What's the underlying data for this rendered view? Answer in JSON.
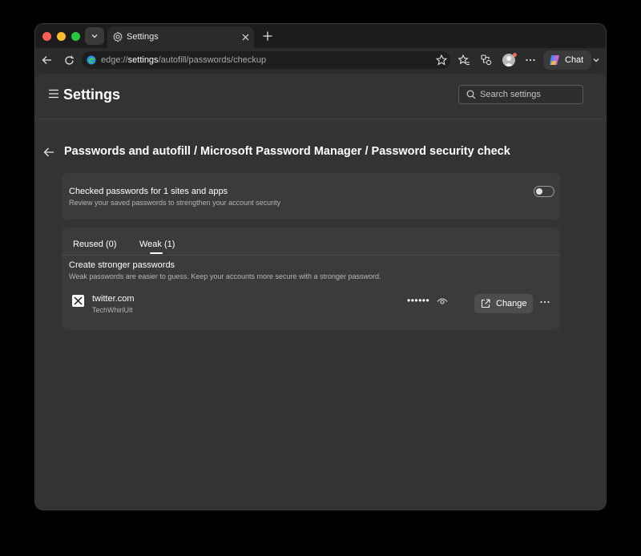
{
  "browser": {
    "tab": {
      "title": "Settings"
    },
    "address": {
      "url_prefix": "edge://",
      "url_bold": "settings",
      "url_rest": "/autofill/passwords/checkup"
    },
    "toolbar": {
      "chat_label": "Chat"
    }
  },
  "settings": {
    "title": "Settings",
    "search": {
      "placeholder": "Search settings"
    },
    "breadcrumb": "Passwords and autofill / Microsoft Password Manager / Password security check"
  },
  "checked_card": {
    "title": "Checked passwords for 1 sites and apps",
    "subtitle": "Review your saved passwords to strengthen your account security",
    "toggle_on": false
  },
  "issues": {
    "tabs": [
      {
        "label": "Reused (0)",
        "selected": false
      },
      {
        "label": "Weak (1)",
        "selected": true
      }
    ],
    "section_title": "Create stronger passwords",
    "section_subtitle": "Weak passwords are easier to guess. Keep your accounts more secure with a stronger password.",
    "entries": [
      {
        "site": "twitter.com",
        "username": "TechWhirlUlt",
        "password_mask": "••••••",
        "change_label": "Change"
      }
    ]
  },
  "colors": {
    "window_bg": "#2b2b2b",
    "content_bg": "#333333",
    "card_bg": "#3b3b3b",
    "button_bg": "#4d4d4d"
  }
}
